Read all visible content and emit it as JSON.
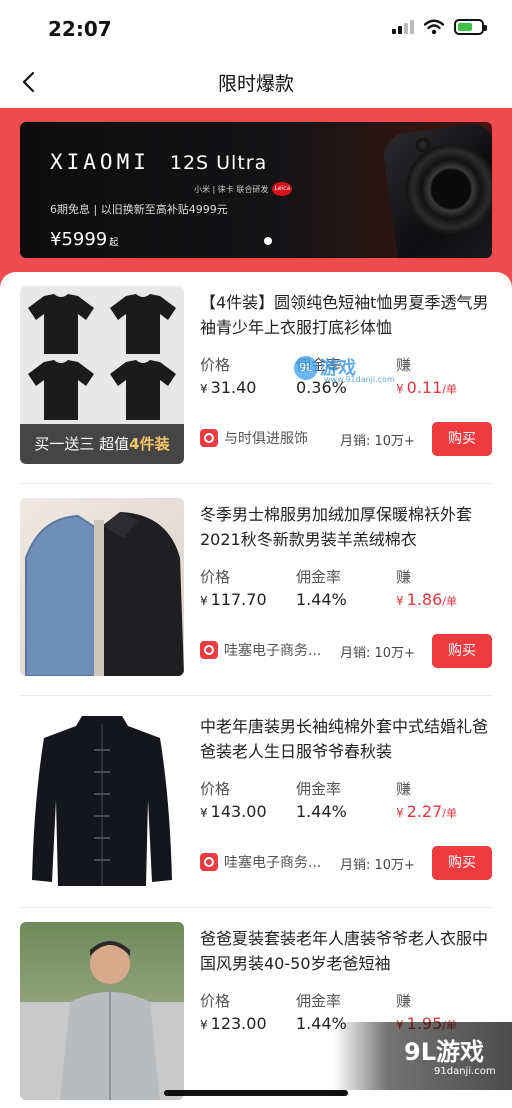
{
  "status": {
    "time": "22:07"
  },
  "nav": {
    "title": "限时爆款"
  },
  "banner": {
    "logo": "XIAOMI",
    "model": "12S Ultra",
    "co_brand": "小米 | 徕卡 联合研发",
    "leica": "Leica",
    "subtitle": "6期免息 | 以旧换新至高补贴4999元",
    "price": "¥5999",
    "price_suffix": "起"
  },
  "labels": {
    "price": "价格",
    "commission": "佣金率",
    "earn": "赚"
  },
  "products": [
    {
      "title": "【4件装】圆领纯色短袖t恤男夏季透气男袖青少年上衣服打底衫体恤",
      "price": "31.40",
      "commission": "0.36%",
      "earn": "0.11",
      "shop": "与时俱进服饰",
      "sales": "月销: 10万+",
      "buy": "购买",
      "promo": "买一送三 超值",
      "promo_highlight": "4件装"
    },
    {
      "title": "冬季男士棉服男加绒加厚保暖棉袄外套2021秋冬新款男装羊羔绒棉衣",
      "price": "117.70",
      "commission": "1.44%",
      "earn": "1.86",
      "shop": "哇塞电子商务...",
      "sales": "月销: 10万+",
      "buy": "购买"
    },
    {
      "title": "中老年唐装男长袖纯棉外套中式结婚礼爸爸装老人生日服爷爷春秋装",
      "price": "143.00",
      "commission": "1.44%",
      "earn": "2.27",
      "shop": "哇塞电子商务...",
      "sales": "月销: 10万+",
      "buy": "购买"
    },
    {
      "title": "爸爸夏装套装老年人唐装爷爷老人衣服中国风男装40-50岁老爸短袖",
      "price": "123.00",
      "commission": "1.44%",
      "earn": "1.95"
    }
  ],
  "currency": "¥",
  "per_unit": "/单",
  "watermark": {
    "mid_text": "游戏",
    "mid_url": "www.91danji.com",
    "badge": "9L",
    "corner_text": "9L游戏",
    "corner_url": "91danji.com"
  },
  "colors": {
    "accent": "#ee3b3f",
    "header": "#ef4b4f"
  }
}
